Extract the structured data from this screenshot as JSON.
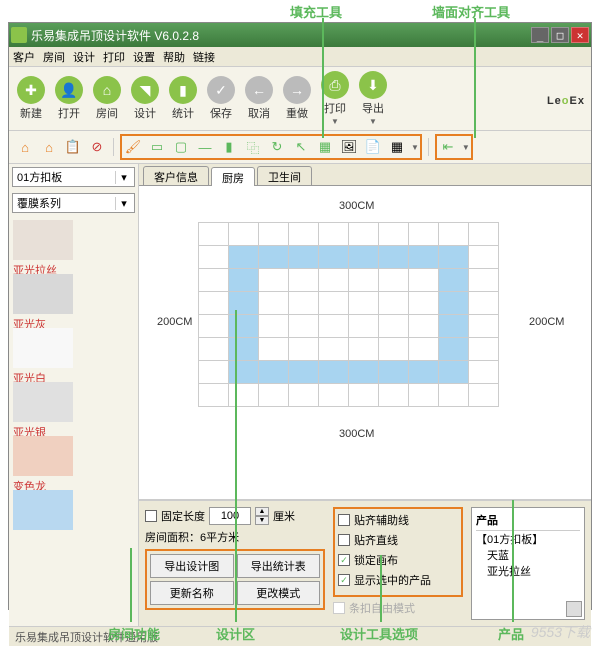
{
  "annotations": {
    "fill_tool": "填充工具",
    "wall_align_tool": "墙面对齐工具",
    "room_func": "房间功能",
    "design_area": "设计区",
    "design_tool_opts": "设计工具选项",
    "products": "产品"
  },
  "window": {
    "title": "乐易集成吊顶设计软件 V6.0.2.8"
  },
  "menu": [
    "客户",
    "房间",
    "设计",
    "打印",
    "设置",
    "帮助",
    "链接"
  ],
  "toolbar": [
    {
      "label": "新建"
    },
    {
      "label": "打开"
    },
    {
      "label": "房间"
    },
    {
      "label": "设计"
    },
    {
      "label": "统计"
    },
    {
      "label": "保存",
      "gray": true
    },
    {
      "label": "取消",
      "gray": true
    },
    {
      "label": "重做",
      "gray": true
    },
    {
      "label": "打印"
    },
    {
      "label": "导出"
    }
  ],
  "logo": {
    "pre": "Le",
    "mid": "o",
    "post": "Ex"
  },
  "left": {
    "combo1": "01方扣板",
    "combo2": "覆膜系列",
    "swatches": [
      {
        "label": "亚光拉丝",
        "red": true,
        "bg": "#e8e0d8"
      },
      {
        "label": "亚光灰",
        "red": true,
        "bg": "#d8d8d8"
      },
      {
        "label": "亚光白",
        "red": true,
        "bg": "#f8f8f8"
      },
      {
        "label": "亚光银",
        "red": true,
        "bg": "#e0e0e0"
      },
      {
        "label": "变色龙",
        "red": true,
        "bg": "#f0d0c0"
      },
      {
        "label": "",
        "red": false,
        "bg": "#b8d8f0"
      }
    ]
  },
  "tabs": [
    "客户信息",
    "厨房",
    "卫生间"
  ],
  "canvas": {
    "top_dim": "300CM",
    "bottom_dim": "300CM",
    "left_dim": "200CM",
    "right_dim": "200CM"
  },
  "bottom": {
    "fixed_length": "固定长度",
    "length_val": "100",
    "length_unit": "厘米",
    "room_area": "房间面积：6平方米",
    "btns": [
      "导出设计图",
      "导出统计表",
      "更新名称",
      "更改模式"
    ],
    "opts": [
      {
        "label": "贴齐辅助线",
        "checked": false
      },
      {
        "label": "贴齐直线",
        "checked": false
      },
      {
        "label": "锁定画布",
        "checked": true
      },
      {
        "label": "显示选中的产品",
        "checked": true
      }
    ],
    "opt_disabled": "条扣自由模式",
    "product_header": "产品",
    "products": [
      "【01方扣板】",
      "　天蓝",
      "　亚光拉丝"
    ]
  },
  "statusbar": "乐易集成吊顶设计软件通用版",
  "watermark": "9553下载"
}
